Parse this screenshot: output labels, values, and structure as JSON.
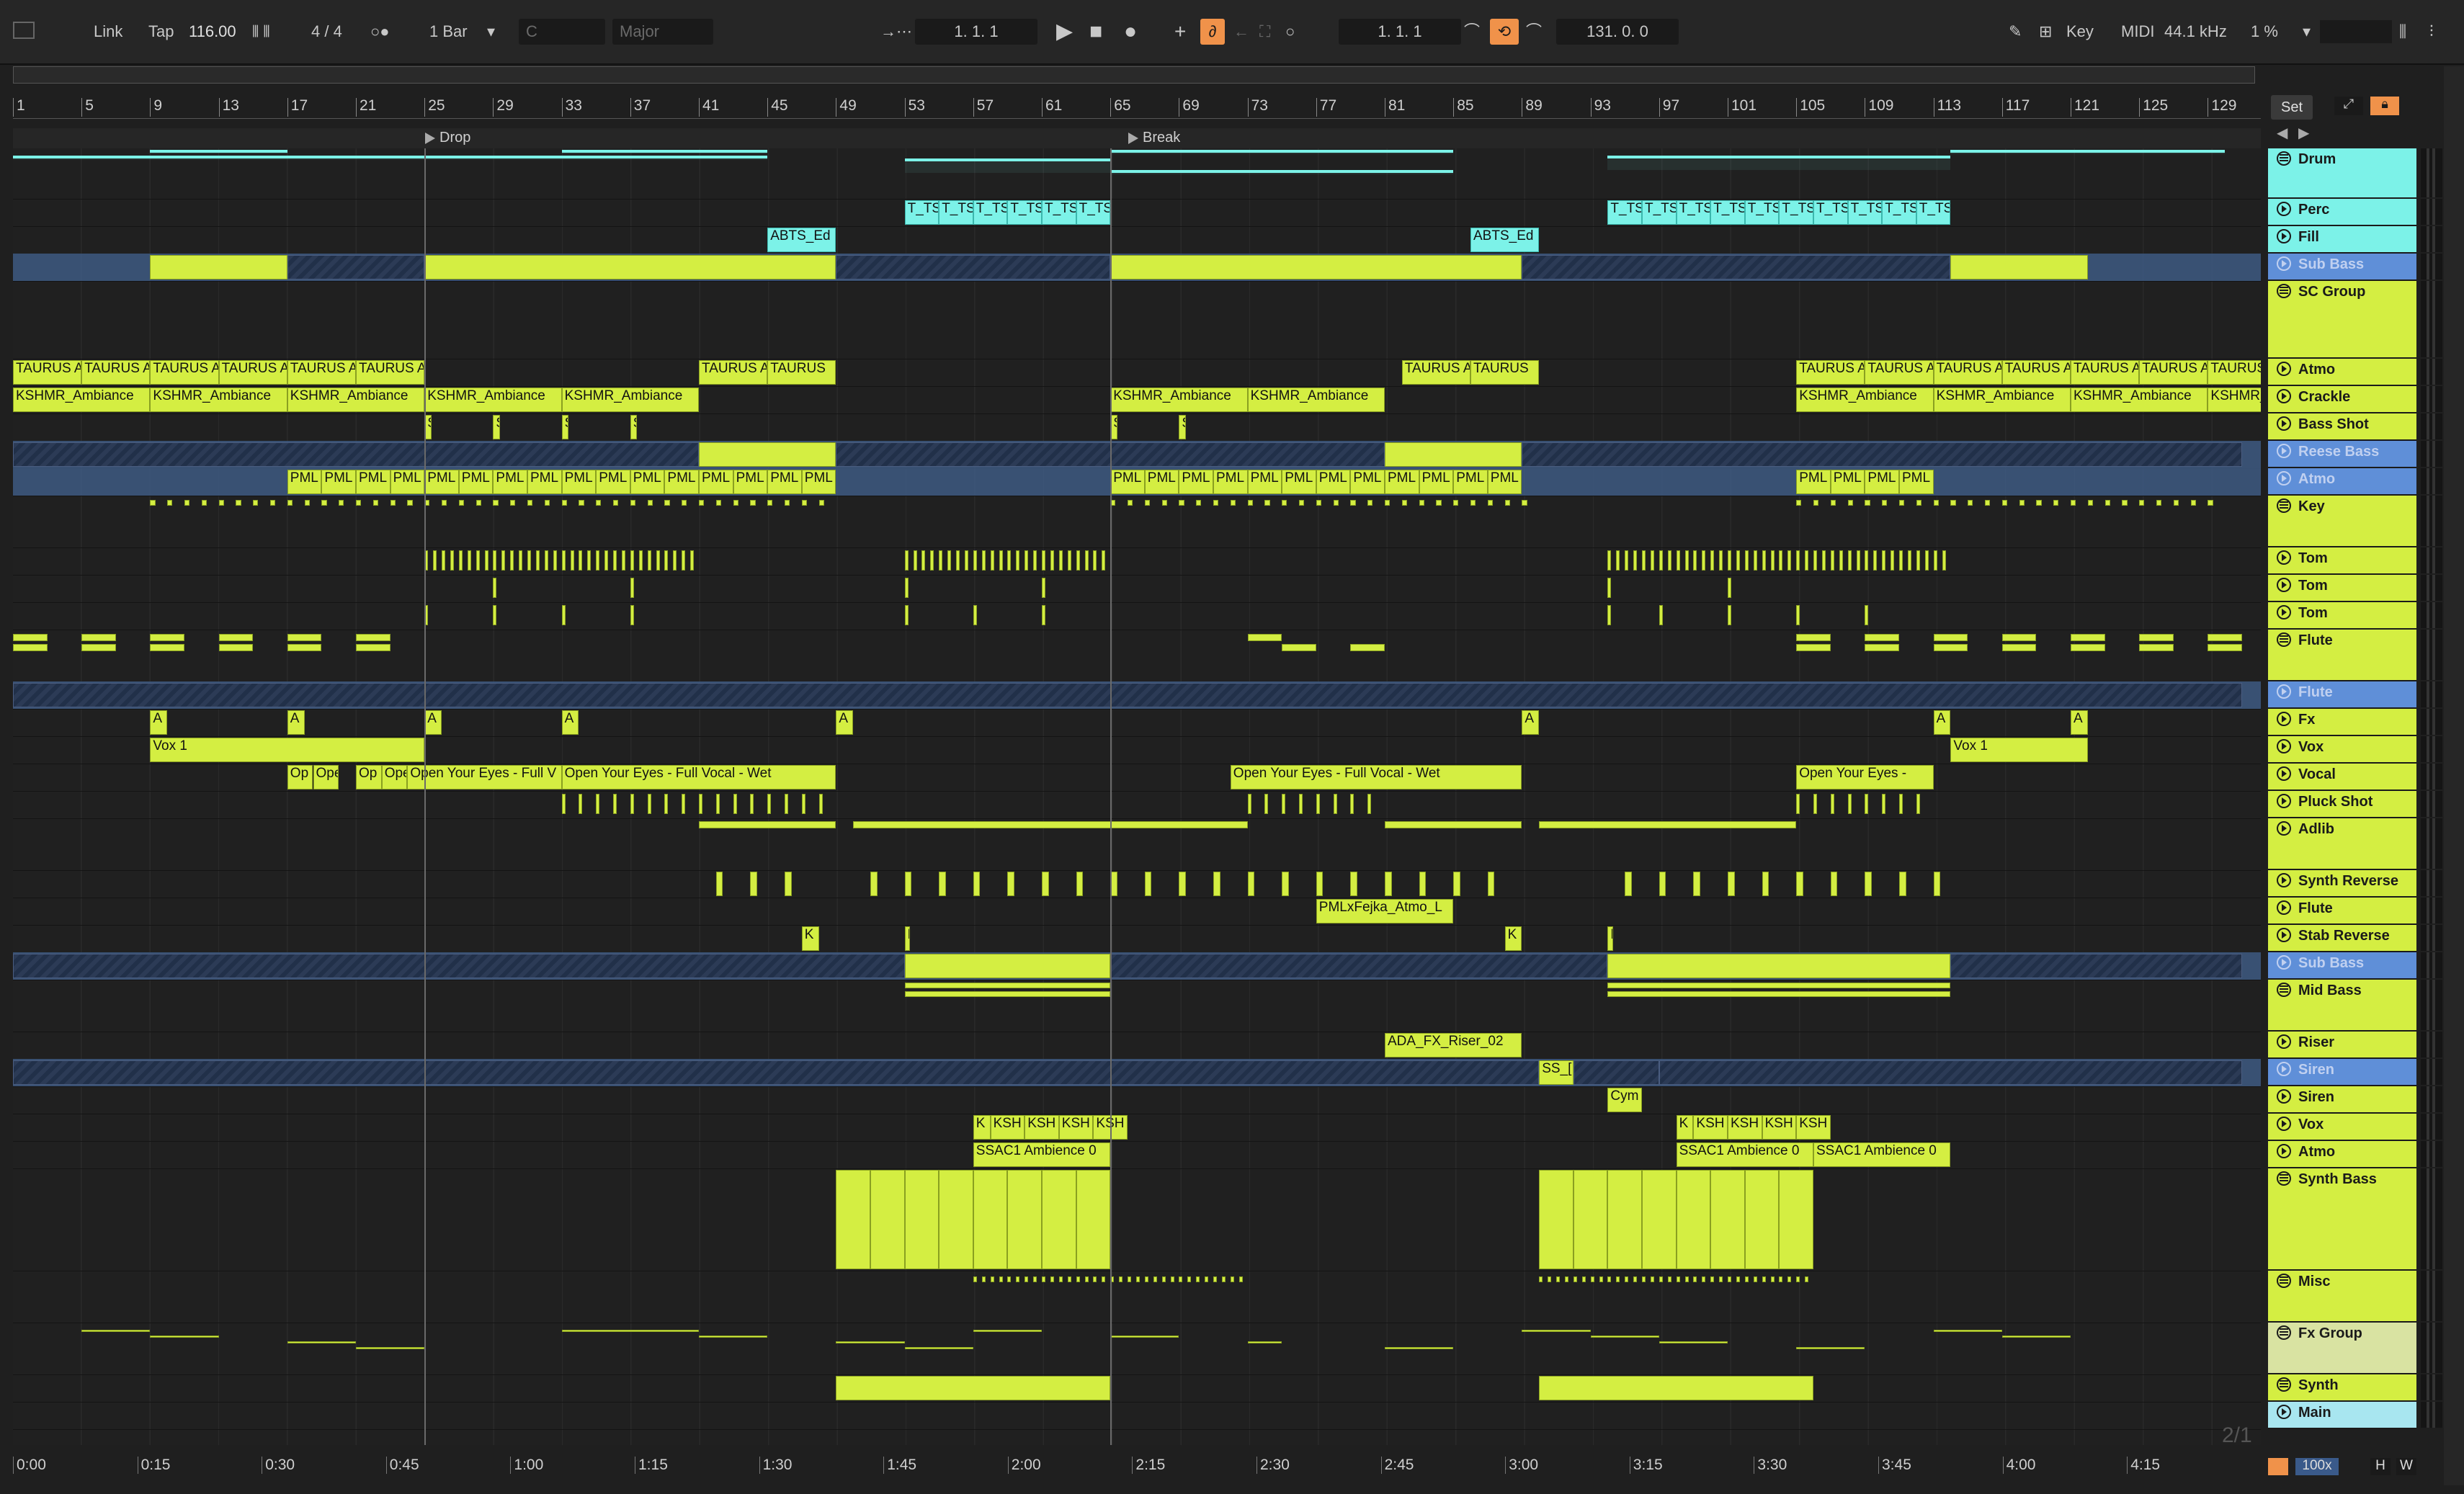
{
  "toolbar": {
    "link": "Link",
    "tap": "Tap",
    "tempo": "116.00",
    "signature": "4 / 4",
    "quantize": "1 Bar",
    "key": "C",
    "scale": "Major",
    "arrangement_position": "1.   1.   1",
    "loop_start": "1.   1.   1",
    "loop_length": "131.   0.   0",
    "key_map": "Key",
    "midi_map": "MIDI",
    "sample_rate": "44.1 kHz",
    "cpu": "1 %"
  },
  "ruler": {
    "bars": [
      "1",
      "5",
      "9",
      "13",
      "17",
      "21",
      "25",
      "29",
      "33",
      "37",
      "41",
      "45",
      "49",
      "53",
      "57",
      "61",
      "65",
      "69",
      "73",
      "77",
      "81",
      "85",
      "89",
      "93",
      "97",
      "101",
      "105",
      "109",
      "113",
      "117",
      "121",
      "125",
      "129"
    ]
  },
  "locators": {
    "drop": "Drop",
    "break": "Break"
  },
  "set_button": "Set",
  "timeline": [
    "0:00",
    "0:15",
    "0:30",
    "0:45",
    "1:00",
    "1:15",
    "1:30",
    "1:45",
    "2:00",
    "2:15",
    "2:30",
    "2:45",
    "3:00",
    "3:15",
    "3:30",
    "3:45",
    "4:00",
    "4:15"
  ],
  "zoom": "100x",
  "h_button": "H",
  "w_button": "W",
  "page_indicator": "2/1",
  "tracks": [
    {
      "name": "Drum",
      "style": "cy",
      "kind": "grp"
    },
    {
      "name": "Perc",
      "style": "cy",
      "kind": "tic"
    },
    {
      "name": "Fill",
      "style": "cy",
      "kind": "tic"
    },
    {
      "name": "Sub Bass",
      "style": "bl",
      "kind": "tic"
    },
    {
      "name": "SC Group",
      "style": "g",
      "kind": "grp"
    },
    {
      "name": "Atmo",
      "style": "g",
      "kind": "tic"
    },
    {
      "name": "Crackle",
      "style": "g",
      "kind": "tic"
    },
    {
      "name": "Bass Shot",
      "style": "g",
      "kind": "tic"
    },
    {
      "name": "Reese Bass",
      "style": "bl",
      "kind": "tic"
    },
    {
      "name": "Atmo",
      "style": "bl",
      "kind": "tic"
    },
    {
      "name": "Key",
      "style": "g",
      "kind": "grp"
    },
    {
      "name": "Tom",
      "style": "g",
      "kind": "tic"
    },
    {
      "name": "Tom",
      "style": "g",
      "kind": "tic"
    },
    {
      "name": "Tom",
      "style": "g",
      "kind": "tic"
    },
    {
      "name": "Flute",
      "style": "g",
      "kind": "grp"
    },
    {
      "name": "Flute",
      "style": "bl",
      "kind": "tic"
    },
    {
      "name": "Fx",
      "style": "g",
      "kind": "tic"
    },
    {
      "name": "Vox",
      "style": "g",
      "kind": "tic"
    },
    {
      "name": "Vocal",
      "style": "g",
      "kind": "tic"
    },
    {
      "name": "Pluck Shot",
      "style": "g",
      "kind": "tic"
    },
    {
      "name": "Adlib",
      "style": "g",
      "kind": "tic"
    },
    {
      "name": "Synth Reverse",
      "style": "g",
      "kind": "tic"
    },
    {
      "name": "Flute",
      "style": "g",
      "kind": "tic"
    },
    {
      "name": "Stab Reverse",
      "style": "g",
      "kind": "tic"
    },
    {
      "name": "Sub Bass",
      "style": "bl",
      "kind": "tic"
    },
    {
      "name": "Mid Bass",
      "style": "g",
      "kind": "grp"
    },
    {
      "name": "Riser",
      "style": "g",
      "kind": "tic"
    },
    {
      "name": "Siren",
      "style": "bl",
      "kind": "tic"
    },
    {
      "name": "Siren",
      "style": "g",
      "kind": "tic"
    },
    {
      "name": "Vox",
      "style": "g",
      "kind": "tic"
    },
    {
      "name": "Atmo",
      "style": "g",
      "kind": "tic"
    },
    {
      "name": "Synth Bass",
      "style": "g",
      "kind": "grp"
    },
    {
      "name": "Misc",
      "style": "g",
      "kind": "grp"
    },
    {
      "name": "Fx Group",
      "style": "pl",
      "kind": "grp"
    },
    {
      "name": "Synth",
      "style": "g",
      "kind": "grp"
    },
    {
      "name": "Main",
      "style": "lb",
      "kind": "tic"
    }
  ],
  "clip_labels": {
    "perc": "T_TS",
    "fill": "ABTS_Ed",
    "atmo": "TAURUS A",
    "atmo_last": "TAURUS",
    "crackle": "KSHMR_Ambiance",
    "bass_shot": "S",
    "atmo_pml": "PML",
    "fx": "A",
    "vox": "Vox 1",
    "vocal_short": "Op",
    "vocal_short2": "Ope",
    "vocal_full": "Open Your Eyes - Full Vocal - Wet",
    "vocal_cut": "Open Your Eyes - Full V",
    "vocal_end": "Open Your Eyes -",
    "flute_atmo": "PMLxFejka_Atmo_L",
    "stab": "K",
    "riser": "ADA_FX_Riser_02",
    "siren": "SS_[",
    "siren2": "Cym",
    "vox_k": "KSH",
    "atmo_ssac": "SSAC1 Ambience 0"
  }
}
